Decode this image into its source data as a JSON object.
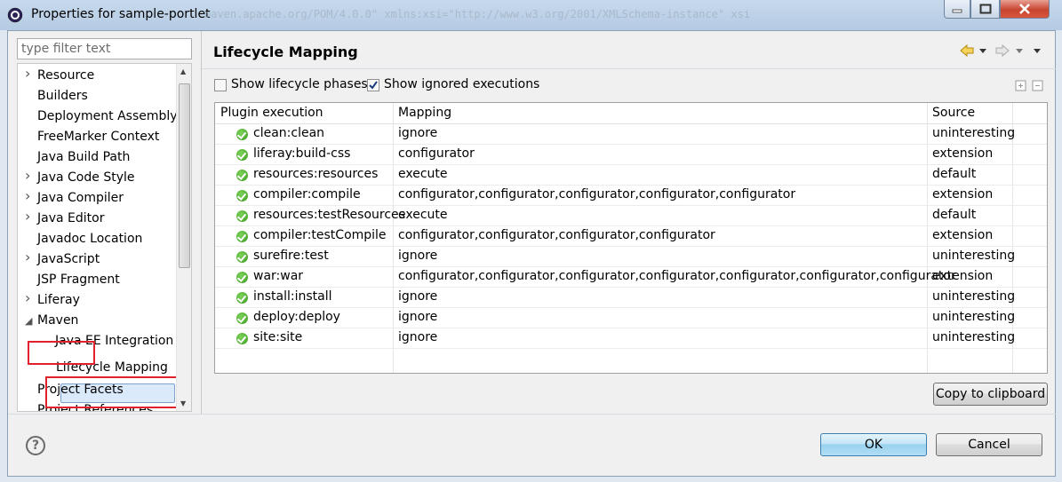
{
  "window": {
    "title": "Properties for sample-portlet",
    "background_text": "maven.apache.org/POM/4.0.0\" xmlns:xsi=\"http://www.w3.org/2001/XMLSchema-instance\" xsi"
  },
  "filter": {
    "placeholder": "type filter text"
  },
  "tree": {
    "items": [
      {
        "label": "Resource",
        "expandable": true
      },
      {
        "label": "Builders"
      },
      {
        "label": "Deployment Assembly"
      },
      {
        "label": "FreeMarker Context"
      },
      {
        "label": "Java Build Path"
      },
      {
        "label": "Java Code Style",
        "expandable": true
      },
      {
        "label": "Java Compiler",
        "expandable": true
      },
      {
        "label": "Java Editor",
        "expandable": true
      },
      {
        "label": "Javadoc Location"
      },
      {
        "label": "JavaScript",
        "expandable": true
      },
      {
        "label": "JSP Fragment"
      },
      {
        "label": "Liferay",
        "expandable": true
      },
      {
        "label": "Maven",
        "expanded": true
      },
      {
        "label": "Java EE Integration"
      },
      {
        "label": "Lifecycle Mapping",
        "selected": true
      },
      {
        "label": "Project Facets"
      },
      {
        "label": "Project References"
      }
    ]
  },
  "main": {
    "title": "Lifecycle Mapping",
    "show_lifecycle_phases": {
      "label": "Show lifecycle phases",
      "checked": false
    },
    "show_ignored_executions": {
      "label": "Show ignored executions",
      "checked": true
    },
    "table": {
      "headers": [
        "Plugin execution",
        "Mapping",
        "Source"
      ],
      "rows": [
        [
          "clean:clean",
          "ignore",
          "uninteresting"
        ],
        [
          "liferay:build-css",
          "configurator",
          "extension"
        ],
        [
          "resources:resources",
          "execute",
          "default"
        ],
        [
          "compiler:compile",
          "configurator,configurator,configurator,configurator,configurator",
          "extension"
        ],
        [
          "resources:testResources",
          "execute",
          "default"
        ],
        [
          "compiler:testCompile",
          "configurator,configurator,configurator,configurator",
          "extension"
        ],
        [
          "surefire:test",
          "ignore",
          "uninteresting"
        ],
        [
          "war:war",
          "configurator,configurator,configurator,configurator,configurator,configurator,configurator",
          "extension"
        ],
        [
          "install:install",
          "ignore",
          "uninteresting"
        ],
        [
          "deploy:deploy",
          "ignore",
          "uninteresting"
        ],
        [
          "site:site",
          "ignore",
          "uninteresting"
        ]
      ]
    },
    "copy_label": "Copy to clipboard"
  },
  "footer": {
    "ok_label": "OK",
    "cancel_label": "Cancel",
    "help_glyph": "?"
  },
  "colors": {
    "highlight_border": "#e0202a",
    "selection_bg": "#dbeafb",
    "status_ok": "#3a9a1f"
  },
  "icons": [
    "eclipse-icon",
    "minimize-icon",
    "maximize-icon",
    "close-icon",
    "back-arrow-icon",
    "forward-arrow-icon",
    "menu-icon",
    "expand-all-icon",
    "collapse-all-icon",
    "status-ok-icon",
    "help-icon"
  ]
}
